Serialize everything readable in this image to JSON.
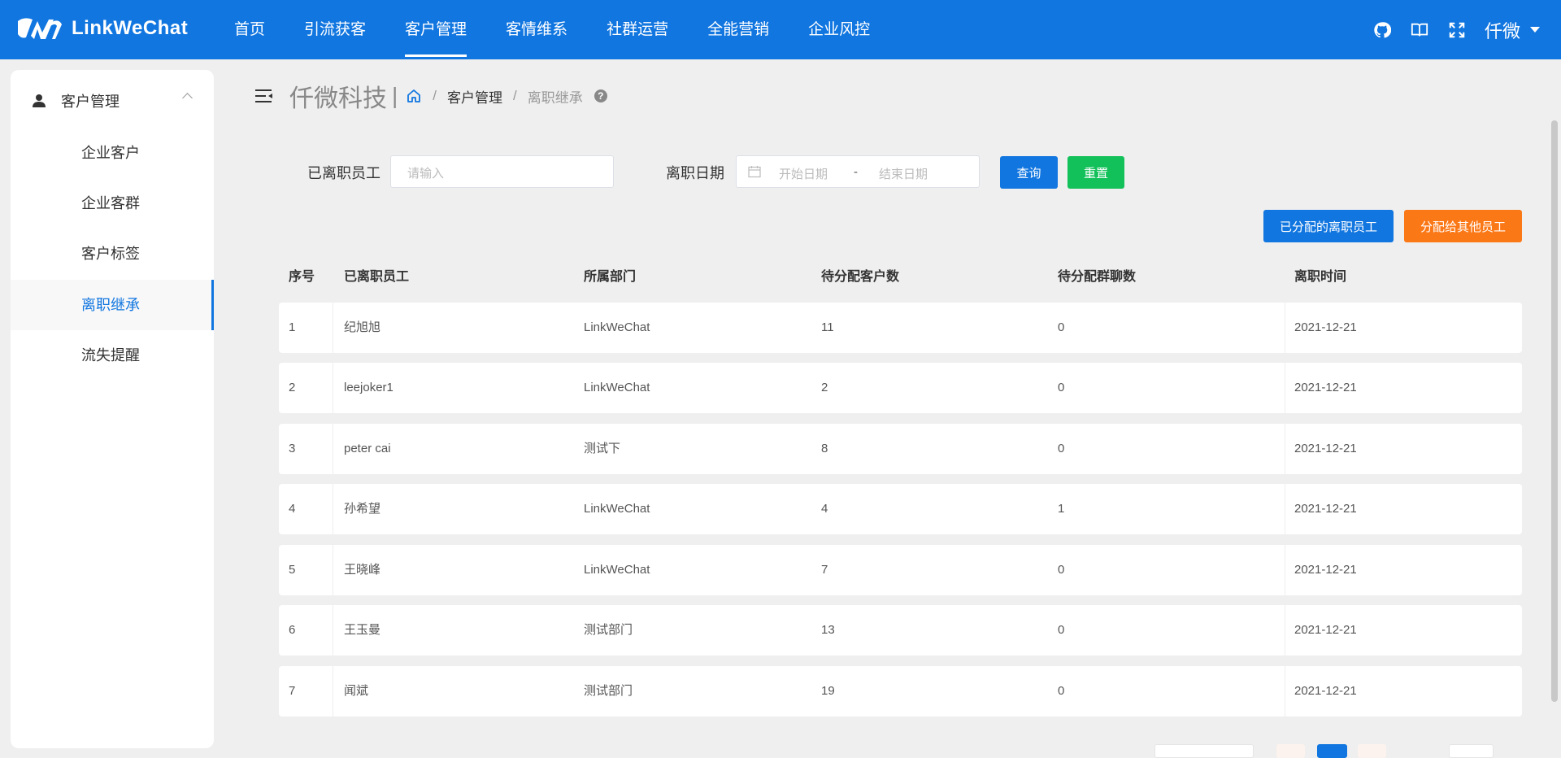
{
  "app": {
    "logo_text": "LinkWeChat"
  },
  "nav": {
    "items": [
      {
        "label": "首页"
      },
      {
        "label": "引流获客"
      },
      {
        "label": "客户管理",
        "active": true
      },
      {
        "label": "客情维系"
      },
      {
        "label": "社群运营"
      },
      {
        "label": "全能营销"
      },
      {
        "label": "企业风控"
      }
    ],
    "icons": [
      "github-icon",
      "book-icon",
      "fullscreen-icon"
    ],
    "user_name": "仟微"
  },
  "sidebar": {
    "section_label": "客户管理",
    "items": [
      {
        "label": "企业客户"
      },
      {
        "label": "企业客群"
      },
      {
        "label": "客户标签"
      },
      {
        "label": "离职继承",
        "active": true
      },
      {
        "label": "流失提醒"
      }
    ]
  },
  "breadcrumb": {
    "brand": "仟微科技",
    "bar": "|",
    "items": [
      "客户管理",
      "离职继承"
    ],
    "separator": "/",
    "help": "?"
  },
  "filters": {
    "employee_label": "已离职员工",
    "employee_placeholder": "请输入",
    "date_label": "离职日期",
    "start_placeholder": "开始日期",
    "date_separator": "-",
    "end_placeholder": "结束日期",
    "query_label": "查询",
    "reset_label": "重置"
  },
  "actions": {
    "assigned_label": "已分配的离职员工",
    "assign_other_label": "分配给其他员工"
  },
  "colors": {
    "primary": "#1176e0",
    "success": "#13c15a",
    "warning": "#fb7817"
  },
  "table": {
    "headers": [
      "序号",
      "已离职员工",
      "所属部门",
      "待分配客户数",
      "待分配群聊数",
      "离职时间"
    ],
    "rows": [
      {
        "index": "1",
        "employee": "纪旭旭",
        "dept": "LinkWeChat",
        "customers": "11",
        "groups": "0",
        "date": "2021-12-21"
      },
      {
        "index": "2",
        "employee": "leejoker1",
        "dept": "LinkWeChat",
        "customers": "2",
        "groups": "0",
        "date": "2021-12-21"
      },
      {
        "index": "3",
        "employee": "peter cai",
        "dept": "测试下",
        "customers": "8",
        "groups": "0",
        "date": "2021-12-21"
      },
      {
        "index": "4",
        "employee": "孙希望",
        "dept": "LinkWeChat",
        "customers": "4",
        "groups": "1",
        "date": "2021-12-21"
      },
      {
        "index": "5",
        "employee": "王晓峰",
        "dept": "LinkWeChat",
        "customers": "7",
        "groups": "0",
        "date": "2021-12-21"
      },
      {
        "index": "6",
        "employee": "王玉曼",
        "dept": "测试部门",
        "customers": "13",
        "groups": "0",
        "date": "2021-12-21"
      },
      {
        "index": "7",
        "employee": "闻斌",
        "dept": "测试部门",
        "customers": "19",
        "groups": "0",
        "date": "2021-12-21"
      }
    ]
  }
}
